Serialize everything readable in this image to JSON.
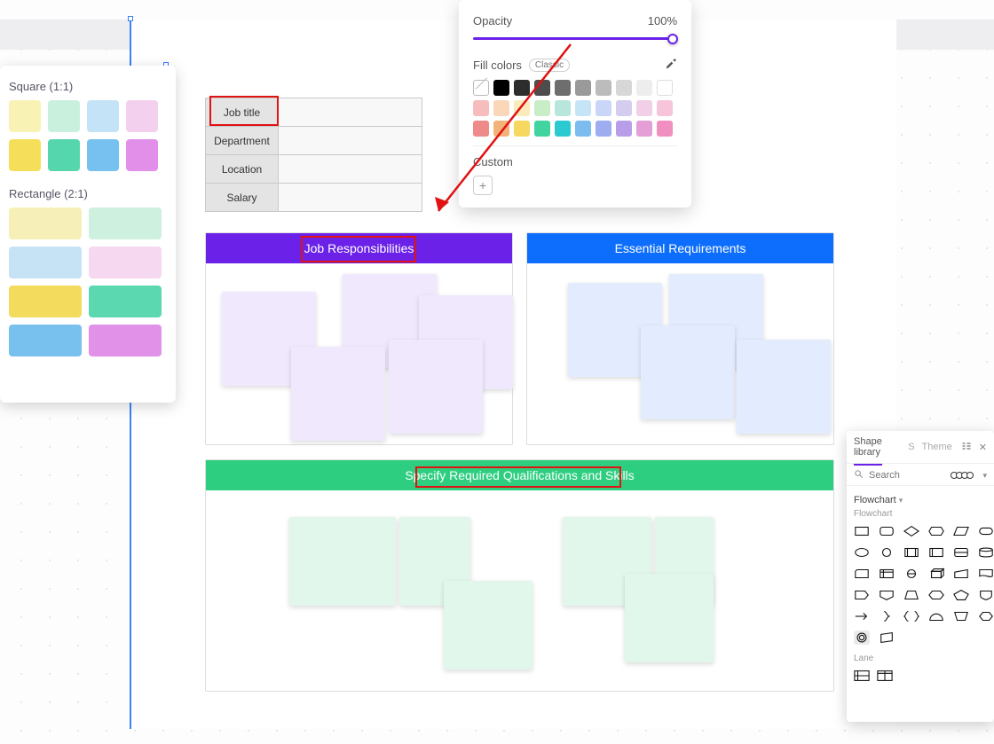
{
  "opacity_panel": {
    "opacity_label": "Opacity",
    "opacity_value": "100%",
    "fill_label": "Fill colors",
    "preset_pill": "Classic",
    "custom_label": "Custom",
    "row1": [
      "#ffffff",
      "#000000",
      "#2d2d2d",
      "#4d4d4d",
      "#6e6e6e",
      "#9a9a9a",
      "#bcbcbc",
      "#d7d7d7",
      "#ededed",
      "#ffffff"
    ],
    "row2": [
      "#f7bcbc",
      "#f9d7b8",
      "#fbeabb",
      "#c8eec8",
      "#b8e6dc",
      "#c5e5f7",
      "#c9d6f7",
      "#d5cdef",
      "#f1cfe7",
      "#f7c5da"
    ],
    "row3": [
      "#ef8a8a",
      "#f2b37a",
      "#f6d861",
      "#42d49f",
      "#2bcad0",
      "#7cbcf0",
      "#9dadf0",
      "#b89ee9",
      "#e39fd6",
      "#f18fc0"
    ]
  },
  "color_panel": {
    "square_label": "Square (1:1)",
    "rect_label": "Rectangle (2:1)",
    "square_colors": [
      "#f8f2b5",
      "#c8f0dd",
      "#c4e3f7",
      "#f3d0ee",
      "#f5de5a",
      "#56d6ad",
      "#77c1f0",
      "#e18fe8"
    ],
    "rect_colors": [
      "#f6f0b8",
      "#cdf0df",
      "#c6e3f6",
      "#f6d9f0",
      "#f3dc5d",
      "#5bd8b0",
      "#78c1ef",
      "#e191e8"
    ]
  },
  "job_table": {
    "rows": [
      "Job title",
      "Department",
      "Location",
      "Salary"
    ]
  },
  "sections": {
    "resp": "Job Responsibilities",
    "req": "Essential Requirements",
    "qual": "Specify Required Qualifications and Skills"
  },
  "shape_panel": {
    "title": "Shape library",
    "tab2": "S",
    "tab3": "Theme",
    "search_placeholder": "Search",
    "section": "Flowchart",
    "subsection": "Flowchart",
    "lane_label": "Lane"
  }
}
